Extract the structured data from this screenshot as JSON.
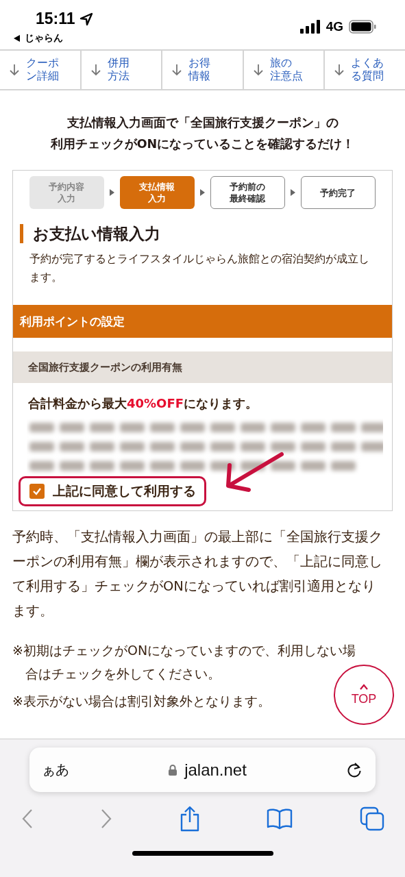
{
  "status_bar": {
    "time": "15:11",
    "back_app": "じゃらん",
    "network": "4G"
  },
  "nav_tabs": [
    {
      "lines": [
        "クーポ",
        "ン詳細"
      ]
    },
    {
      "lines": [
        "併用",
        "方法"
      ]
    },
    {
      "lines": [
        "お得",
        "情報"
      ]
    },
    {
      "lines": [
        "旅の",
        "注意点"
      ]
    },
    {
      "lines": [
        "よくあ",
        "る質問"
      ]
    }
  ],
  "headline": [
    "支払情報入力画面で「全国旅行支援クーポン」の",
    "利用チェックがONになっていることを確認するだけ！"
  ],
  "screenshot": {
    "steps": [
      {
        "lines": [
          "予約内容",
          "入力"
        ],
        "kind": "past"
      },
      {
        "lines": [
          "支払情報",
          "入力"
        ],
        "kind": "current"
      },
      {
        "lines": [
          "予約前の",
          "最終確認"
        ],
        "kind": "future"
      },
      {
        "lines": [
          "予約完了"
        ],
        "kind": "future"
      }
    ],
    "title": "お支払い情報入力",
    "description": "予約が完了するとライフスタイルじゃらん旅館との宿泊契約が成立します。",
    "section_header": "利用ポイントの設定",
    "subsection_header": "全国旅行支援クーポンの利用有無",
    "discount_note": "合計料金から最大**40%OFF**になります。",
    "consent": {
      "label": "上記に同意して利用する",
      "checked": true
    }
  },
  "body": "予約時、「支払情報入力画面」の最上部に「全国旅行支援クーポンの利用有無」欄が表示されますので、「上記に同意して利用する」チェックがONになっていれば割引適用となります。",
  "notes": [
    "※初期はチェックがONになっていますので、利用しない場合はチェックを外してください。",
    "※表示がない場合は割引対象外となります。"
  ],
  "top_button": {
    "label": "TOP"
  },
  "browser": {
    "text_size": "ぁあ",
    "url": "jalan.net",
    "back_enabled": false,
    "forward_enabled": false
  }
}
